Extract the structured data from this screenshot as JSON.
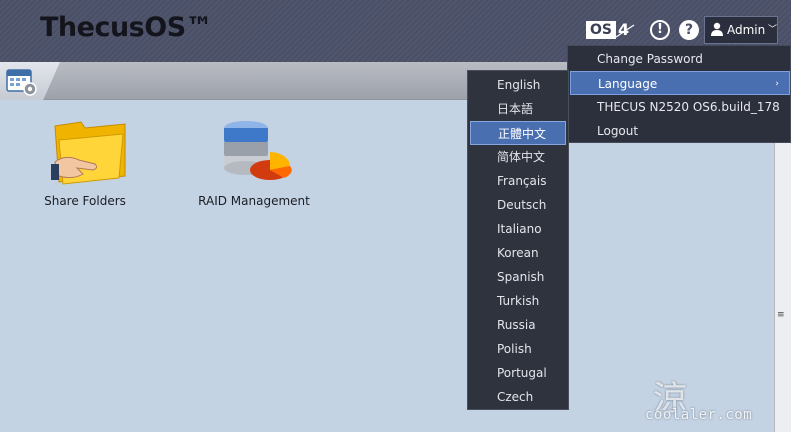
{
  "header": {
    "logo_text": "ThecusOS™",
    "os_badge": {
      "label": "OS",
      "version": "4"
    },
    "icons": {
      "alert": "exclamation-circle-icon",
      "help": "question-circle-icon"
    },
    "alert_glyph": "!",
    "help_glyph": "?",
    "admin_label": "Admin",
    "admin_chevron": "﹀"
  },
  "apps": [
    {
      "label": "Share Folders",
      "icon": "share-folders-icon"
    },
    {
      "label": "RAID Management",
      "icon": "raid-management-icon"
    }
  ],
  "admin_menu": {
    "items": [
      {
        "label": "Change Password"
      },
      {
        "label": "Language",
        "arrow": "›"
      },
      {
        "label": "THECUS N2520 OS6.build_178"
      },
      {
        "label": "Logout"
      }
    ],
    "active_index": 1
  },
  "language_menu": {
    "items": [
      "English",
      "日本語",
      "正體中文",
      "简体中文",
      "Français",
      "Deutsch",
      "Italiano",
      "Korean",
      "Spanish",
      "Turkish",
      "Russia",
      "Polish",
      "Portugal",
      "Czech"
    ],
    "selected_index": 2
  },
  "scrollbar_grip": "≡",
  "watermark": {
    "text": "coolaler.com",
    "glyph": "涼"
  },
  "colors": {
    "header_bg": "#4a4f66",
    "menu_bg": "#2c303c",
    "highlight": "#4a6fb0",
    "content_bg": "#c4d3e3"
  }
}
